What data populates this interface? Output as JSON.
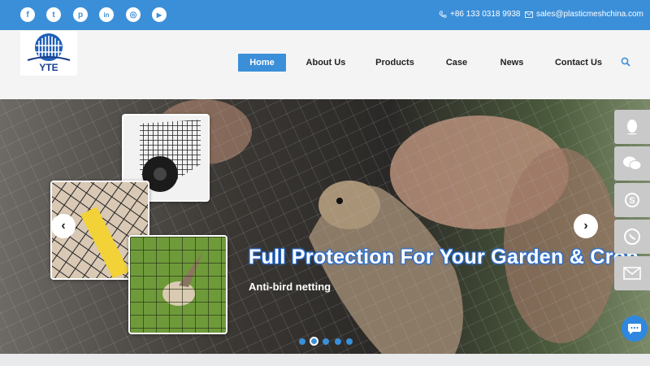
{
  "topbar": {
    "social": [
      {
        "icon": "facebook-icon",
        "glyph": "f"
      },
      {
        "icon": "twitter-icon",
        "glyph": "t"
      },
      {
        "icon": "pinterest-icon",
        "glyph": "p"
      },
      {
        "icon": "linkedin-icon",
        "glyph": "in"
      },
      {
        "icon": "instagram-icon",
        "glyph": "◎"
      },
      {
        "icon": "youtube-icon",
        "glyph": "▶"
      }
    ],
    "phone": "+86 133 0318 9938",
    "email": "sales@plasticmeshchina.com"
  },
  "logo": {
    "text": "YTE"
  },
  "nav": {
    "items": [
      "Home",
      "About Us",
      "Products",
      "Case",
      "News",
      "Contact Us"
    ],
    "active": "Home"
  },
  "hero": {
    "title": "Full Protection For Your Garden & Crop",
    "subtitle": "Anti-bird netting",
    "slide_count": 5,
    "active_slide": 2
  },
  "sidebar": {
    "buttons": [
      "qq-icon",
      "wechat-icon",
      "skype-icon",
      "whatsapp-icon",
      "email-icon"
    ]
  },
  "colors": {
    "accent": "#3b8fd9",
    "sidebar": "#c9c9c9"
  }
}
